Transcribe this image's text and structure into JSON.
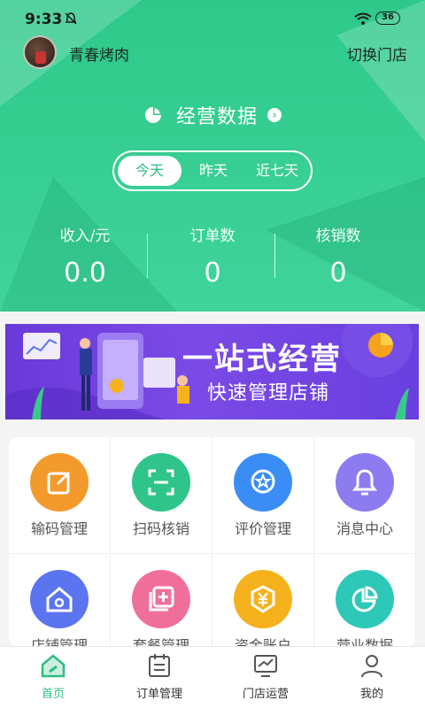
{
  "status_bar": {
    "time": "9:33",
    "battery": "36"
  },
  "header": {
    "store_name": "青春烤肉",
    "switch_store": "切换门店",
    "ops_title": "经营数据",
    "segments": [
      "今天",
      "昨天",
      "近七天"
    ],
    "active_segment": "今天",
    "stats": [
      {
        "label": "收入/元",
        "value": "0.0"
      },
      {
        "label": "订单数",
        "value": "0"
      },
      {
        "label": "核销数",
        "value": "0"
      }
    ]
  },
  "banner": {
    "title": "一站式经营",
    "subtitle": "快速管理店铺"
  },
  "grid": {
    "items": [
      {
        "label": "输码管理",
        "icon": "edit-icon",
        "color": "#f39a2c"
      },
      {
        "label": "扫码核销",
        "icon": "scan-icon",
        "color": "#2fc58a"
      },
      {
        "label": "评价管理",
        "icon": "review-star-icon",
        "color": "#3a8df5"
      },
      {
        "label": "消息中心",
        "icon": "bell-icon",
        "color": "#8c7cf0"
      },
      {
        "label": "店铺管理",
        "icon": "store-gear-icon",
        "color": "#5b74f0"
      },
      {
        "label": "套餐管理",
        "icon": "package-add-icon",
        "color": "#f06f9a"
      },
      {
        "label": "资金账户",
        "icon": "yuan-shield-icon",
        "color": "#f6b21c"
      },
      {
        "label": "营业数据",
        "icon": "pie-chart-icon",
        "color": "#2ec8b8"
      }
    ]
  },
  "tabbar": {
    "items": [
      {
        "label": "首页",
        "icon": "home-icon"
      },
      {
        "label": "订单管理",
        "icon": "orders-icon"
      },
      {
        "label": "门店运营",
        "icon": "operations-icon"
      },
      {
        "label": "我的",
        "icon": "profile-icon"
      }
    ],
    "active": "首页"
  },
  "colors": {
    "primary": "#2ec98a",
    "banner": "#6a39d9"
  }
}
